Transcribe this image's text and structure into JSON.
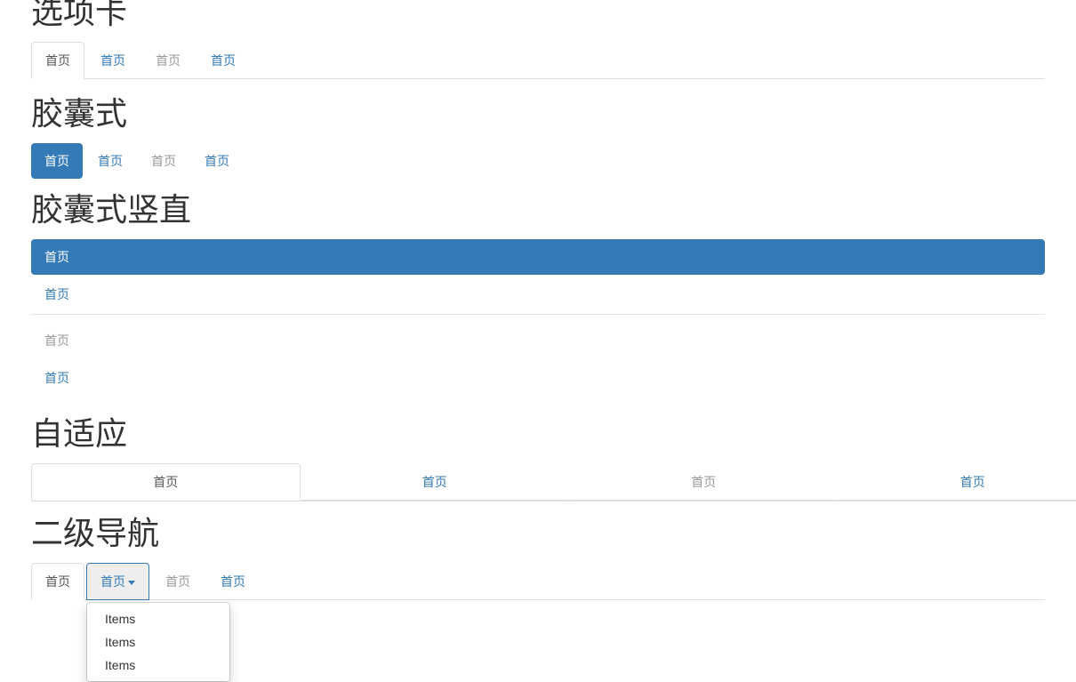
{
  "sections": {
    "tabs": {
      "title": "选项卡",
      "items": [
        {
          "label": "首页",
          "state": "active"
        },
        {
          "label": "首页",
          "state": "link"
        },
        {
          "label": "首页",
          "state": "disabled"
        },
        {
          "label": "首页",
          "state": "link"
        }
      ]
    },
    "pills": {
      "title": "胶囊式",
      "items": [
        {
          "label": "首页",
          "state": "active"
        },
        {
          "label": "首页",
          "state": "link"
        },
        {
          "label": "首页",
          "state": "disabled"
        },
        {
          "label": "首页",
          "state": "link"
        }
      ]
    },
    "stacked": {
      "title": "胶囊式竖直",
      "items": [
        {
          "label": "首页",
          "state": "active"
        },
        {
          "label": "首页",
          "state": "link"
        },
        {
          "label": "",
          "state": "divider"
        },
        {
          "label": "首页",
          "state": "disabled"
        },
        {
          "label": "首页",
          "state": "link"
        }
      ]
    },
    "justified": {
      "title": "自适应",
      "items": [
        {
          "label": "首页",
          "state": "active"
        },
        {
          "label": "首页",
          "state": "link"
        },
        {
          "label": "首页",
          "state": "disabled"
        },
        {
          "label": "首页",
          "state": "link"
        }
      ]
    },
    "subnav": {
      "title": "二级导航",
      "items": [
        {
          "label": "首页",
          "state": "active"
        },
        {
          "label": "首页",
          "state": "open-dropdown"
        },
        {
          "label": "首页",
          "state": "disabled"
        },
        {
          "label": "首页",
          "state": "link"
        }
      ],
      "dropdown": {
        "items": [
          {
            "label": "Items"
          },
          {
            "label": "Items"
          },
          {
            "label": "Items"
          }
        ]
      }
    }
  },
  "colors": {
    "primary": "#337ab7",
    "active_text": "#555555",
    "link": "#337ab7",
    "disabled": "#999999",
    "border": "#dddddd",
    "divider": "#e5e5e5",
    "dropdown_open_bg": "#eeeeee"
  }
}
